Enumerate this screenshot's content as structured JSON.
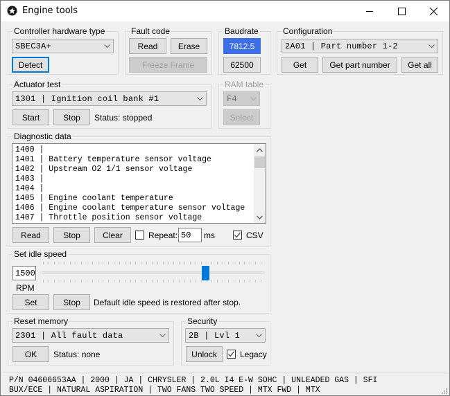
{
  "window": {
    "title": "Engine tools",
    "controls": {
      "minimize": "—",
      "maximize": "☐",
      "close": "✕"
    }
  },
  "controller": {
    "label": "Controller hardware type",
    "selected": "SBEC3A+",
    "detect_label": "Detect"
  },
  "fault_code": {
    "label": "Fault code",
    "read_label": "Read",
    "erase_label": "Erase",
    "freeze_frame_label": "Freeze Frame"
  },
  "baudrate": {
    "label": "Baudrate",
    "options": [
      "7812.5",
      "62500"
    ],
    "selected": "7812.5"
  },
  "configuration": {
    "label": "Configuration",
    "selected": "2A01 | Part number 1-2",
    "get_label": "Get",
    "get_part_number_label": "Get part number",
    "get_all_label": "Get all"
  },
  "actuator_test": {
    "label": "Actuator test",
    "selected": "1301 | Ignition coil bank #1",
    "start_label": "Start",
    "stop_label": "Stop",
    "status": "Status: stopped"
  },
  "ram_table": {
    "label": "RAM table",
    "selected": "F4",
    "select_label": "Select"
  },
  "diagnostic_data": {
    "label": "Diagnostic data",
    "lines": [
      "1400 |",
      "1401 | Battery temperature sensor voltage",
      "1402 | Upstream O2 1/1 sensor voltage",
      "1403 |",
      "1404 |",
      "1405 | Engine coolant temperature",
      "1406 | Engine coolant temperature sensor voltage",
      "1407 | Throttle position sensor voltage"
    ],
    "read_label": "Read",
    "stop_label": "Stop",
    "clear_label": "Clear",
    "repeat_label": "Repeat:",
    "repeat_checked": false,
    "repeat_value": "50",
    "repeat_unit": "ms",
    "csv_label": "CSV",
    "csv_checked": true
  },
  "idle_speed": {
    "label": "Set idle speed",
    "value": "1500",
    "unit": "RPM",
    "slider_fraction": 0.745,
    "set_label": "Set",
    "stop_label": "Stop",
    "note": "Default idle speed is restored after stop."
  },
  "reset_memory": {
    "label": "Reset memory",
    "selected": "2301 | All fault data",
    "ok_label": "OK",
    "status": "Status: none"
  },
  "security": {
    "label": "Security",
    "selected": "2B | Lvl 1",
    "unlock_label": "Unlock",
    "legacy_label": "Legacy",
    "legacy_checked": true
  },
  "status_bar": {
    "line1": "P/N 04606653AA | 2000 | JA | CHRYSLER | 2.0L I4 E-W SOHC | UNLEADED GAS | SFI",
    "line2": "BUX/ECE | NATURAL ASPIRATION | TWO FANS TWO SPEED | MTX FWD | MTX"
  }
}
